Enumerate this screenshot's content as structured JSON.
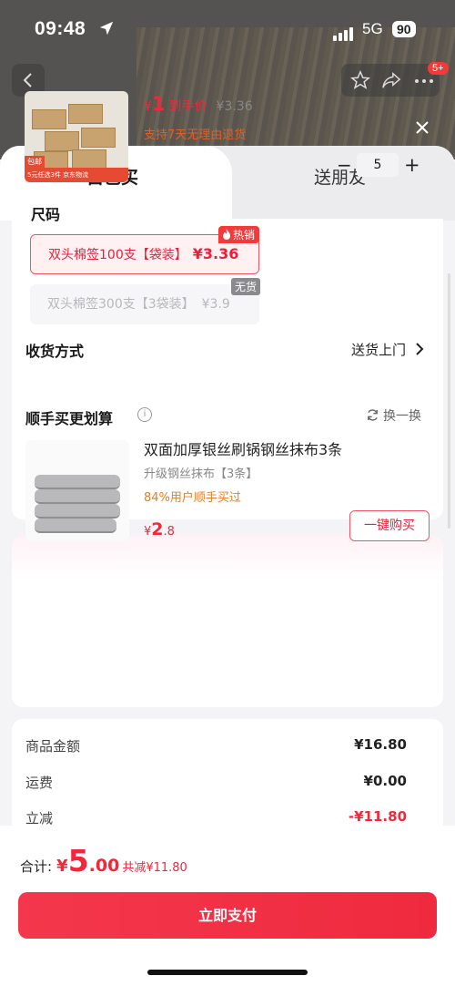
{
  "status_bar": {
    "time": "09:48",
    "network": "5G",
    "battery": "90"
  },
  "nav": {
    "cart_badge": "5+"
  },
  "tabs": {
    "self": "自己买",
    "friend": "送朋友"
  },
  "product": {
    "image_footer": "5元任选3件 京东物流",
    "image_tag": "包邮",
    "price_currency": "¥",
    "price": "1",
    "price_label": "到手价",
    "original_price": "¥3.36",
    "returns_note": "支持7天无理由退货",
    "quantity": "5",
    "minus": "−",
    "plus": "+"
  },
  "size": {
    "title": "尺码",
    "options": [
      {
        "label": "双头棉签100支【袋装】",
        "price": "¥3.36",
        "tag": "热销",
        "selected": true
      },
      {
        "label": "双头棉签300支【3袋装】",
        "price": "¥3.9",
        "tag": "无货",
        "selected": false
      }
    ]
  },
  "shipping": {
    "label": "收货方式",
    "value": "送货上门"
  },
  "addon": {
    "title": "顺手买更划算",
    "swap_label": "换一换",
    "item_title": "双面加厚银丝刷锅钢丝抹布3条",
    "item_sub": "升级钢丝抹布【3条】",
    "item_stat": "84%用户顺手买过",
    "price_currency": "¥",
    "price_int": "2",
    "price_dec": ".8",
    "buy_label": "一键购买"
  },
  "summary": {
    "rows": [
      {
        "label": "商品金额",
        "value": "¥16.80"
      },
      {
        "label": "运费",
        "value": "¥0.00"
      },
      {
        "label": "立减",
        "value": "-¥11.80"
      }
    ]
  },
  "footer": {
    "total_label": "合计:",
    "total_currency": "¥",
    "total_int": "5",
    "total_dec": ".00",
    "saved": "共减¥11.80",
    "pay_label": "立即支付"
  },
  "colors": {
    "accent": "#f2273a",
    "discount_orange": "#e0602a"
  }
}
